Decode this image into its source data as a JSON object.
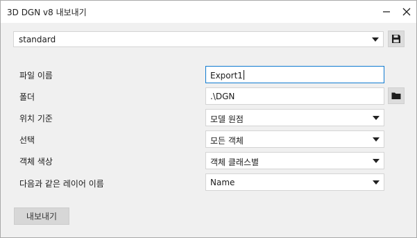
{
  "window": {
    "title": "3D DGN v8 내보내기"
  },
  "profile": {
    "selected": "standard",
    "save_icon": "save-disk-icon"
  },
  "form": {
    "rows": [
      {
        "label": "파일 이름",
        "value": "Export1",
        "kind": "text-input"
      },
      {
        "label": "폴더",
        "value": ".\\DGN",
        "kind": "text-input"
      },
      {
        "label": "위치 기준",
        "value": "모델 원점",
        "kind": "dropdown"
      },
      {
        "label": "선택",
        "value": "모든 객체",
        "kind": "dropdown"
      },
      {
        "label": "객체 색상",
        "value": "객체 클래스별",
        "kind": "dropdown"
      },
      {
        "label": "다음과 같은 레이어 이름",
        "value": "Name",
        "kind": "dropdown"
      }
    ],
    "folder_icon": "folder-icon"
  },
  "actions": {
    "export_label": "내보내기"
  },
  "colors": {
    "focus_border": "#0e7ad0",
    "background": "#f0f0f0",
    "button": "#d7d7d7"
  }
}
